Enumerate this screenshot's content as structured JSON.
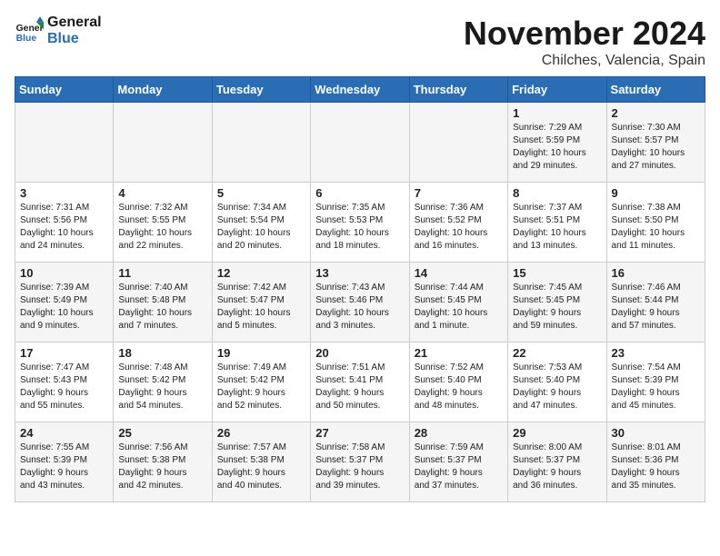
{
  "logo": {
    "line1": "General",
    "line2": "Blue"
  },
  "title": "November 2024",
  "location": "Chilches, Valencia, Spain",
  "weekdays": [
    "Sunday",
    "Monday",
    "Tuesday",
    "Wednesday",
    "Thursday",
    "Friday",
    "Saturday"
  ],
  "weeks": [
    [
      {
        "day": "",
        "info": ""
      },
      {
        "day": "",
        "info": ""
      },
      {
        "day": "",
        "info": ""
      },
      {
        "day": "",
        "info": ""
      },
      {
        "day": "",
        "info": ""
      },
      {
        "day": "1",
        "info": "Sunrise: 7:29 AM\nSunset: 5:59 PM\nDaylight: 10 hours\nand 29 minutes."
      },
      {
        "day": "2",
        "info": "Sunrise: 7:30 AM\nSunset: 5:57 PM\nDaylight: 10 hours\nand 27 minutes."
      }
    ],
    [
      {
        "day": "3",
        "info": "Sunrise: 7:31 AM\nSunset: 5:56 PM\nDaylight: 10 hours\nand 24 minutes."
      },
      {
        "day": "4",
        "info": "Sunrise: 7:32 AM\nSunset: 5:55 PM\nDaylight: 10 hours\nand 22 minutes."
      },
      {
        "day": "5",
        "info": "Sunrise: 7:34 AM\nSunset: 5:54 PM\nDaylight: 10 hours\nand 20 minutes."
      },
      {
        "day": "6",
        "info": "Sunrise: 7:35 AM\nSunset: 5:53 PM\nDaylight: 10 hours\nand 18 minutes."
      },
      {
        "day": "7",
        "info": "Sunrise: 7:36 AM\nSunset: 5:52 PM\nDaylight: 10 hours\nand 16 minutes."
      },
      {
        "day": "8",
        "info": "Sunrise: 7:37 AM\nSunset: 5:51 PM\nDaylight: 10 hours\nand 13 minutes."
      },
      {
        "day": "9",
        "info": "Sunrise: 7:38 AM\nSunset: 5:50 PM\nDaylight: 10 hours\nand 11 minutes."
      }
    ],
    [
      {
        "day": "10",
        "info": "Sunrise: 7:39 AM\nSunset: 5:49 PM\nDaylight: 10 hours\nand 9 minutes."
      },
      {
        "day": "11",
        "info": "Sunrise: 7:40 AM\nSunset: 5:48 PM\nDaylight: 10 hours\nand 7 minutes."
      },
      {
        "day": "12",
        "info": "Sunrise: 7:42 AM\nSunset: 5:47 PM\nDaylight: 10 hours\nand 5 minutes."
      },
      {
        "day": "13",
        "info": "Sunrise: 7:43 AM\nSunset: 5:46 PM\nDaylight: 10 hours\nand 3 minutes."
      },
      {
        "day": "14",
        "info": "Sunrise: 7:44 AM\nSunset: 5:45 PM\nDaylight: 10 hours\nand 1 minute."
      },
      {
        "day": "15",
        "info": "Sunrise: 7:45 AM\nSunset: 5:45 PM\nDaylight: 9 hours\nand 59 minutes."
      },
      {
        "day": "16",
        "info": "Sunrise: 7:46 AM\nSunset: 5:44 PM\nDaylight: 9 hours\nand 57 minutes."
      }
    ],
    [
      {
        "day": "17",
        "info": "Sunrise: 7:47 AM\nSunset: 5:43 PM\nDaylight: 9 hours\nand 55 minutes."
      },
      {
        "day": "18",
        "info": "Sunrise: 7:48 AM\nSunset: 5:42 PM\nDaylight: 9 hours\nand 54 minutes."
      },
      {
        "day": "19",
        "info": "Sunrise: 7:49 AM\nSunset: 5:42 PM\nDaylight: 9 hours\nand 52 minutes."
      },
      {
        "day": "20",
        "info": "Sunrise: 7:51 AM\nSunset: 5:41 PM\nDaylight: 9 hours\nand 50 minutes."
      },
      {
        "day": "21",
        "info": "Sunrise: 7:52 AM\nSunset: 5:40 PM\nDaylight: 9 hours\nand 48 minutes."
      },
      {
        "day": "22",
        "info": "Sunrise: 7:53 AM\nSunset: 5:40 PM\nDaylight: 9 hours\nand 47 minutes."
      },
      {
        "day": "23",
        "info": "Sunrise: 7:54 AM\nSunset: 5:39 PM\nDaylight: 9 hours\nand 45 minutes."
      }
    ],
    [
      {
        "day": "24",
        "info": "Sunrise: 7:55 AM\nSunset: 5:39 PM\nDaylight: 9 hours\nand 43 minutes."
      },
      {
        "day": "25",
        "info": "Sunrise: 7:56 AM\nSunset: 5:38 PM\nDaylight: 9 hours\nand 42 minutes."
      },
      {
        "day": "26",
        "info": "Sunrise: 7:57 AM\nSunset: 5:38 PM\nDaylight: 9 hours\nand 40 minutes."
      },
      {
        "day": "27",
        "info": "Sunrise: 7:58 AM\nSunset: 5:37 PM\nDaylight: 9 hours\nand 39 minutes."
      },
      {
        "day": "28",
        "info": "Sunrise: 7:59 AM\nSunset: 5:37 PM\nDaylight: 9 hours\nand 37 minutes."
      },
      {
        "day": "29",
        "info": "Sunrise: 8:00 AM\nSunset: 5:37 PM\nDaylight: 9 hours\nand 36 minutes."
      },
      {
        "day": "30",
        "info": "Sunrise: 8:01 AM\nSunset: 5:36 PM\nDaylight: 9 hours\nand 35 minutes."
      }
    ]
  ]
}
